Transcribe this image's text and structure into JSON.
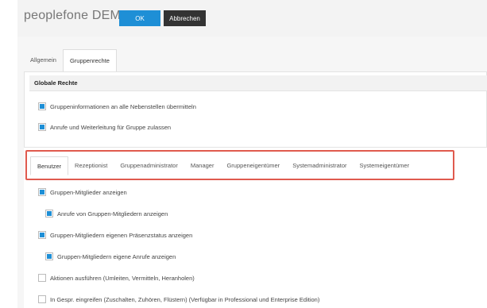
{
  "header": {
    "title": "peoplefone DEMO",
    "ok_label": "OK",
    "cancel_label": "Abbrechen"
  },
  "main_tabs": [
    {
      "label": "Allgemein",
      "active": false
    },
    {
      "label": "Gruppenrechte",
      "active": true
    }
  ],
  "global_rights": {
    "title": "Globale Rechte",
    "options": [
      {
        "label": "Gruppeninformationen an alle Nebenstellen übermitteln",
        "checked": true
      },
      {
        "label": "Anrufe und Weiterleitung für Gruppe zulassen",
        "checked": true
      }
    ]
  },
  "role_tabs": [
    {
      "label": "Benutzer",
      "active": true
    },
    {
      "label": "Rezeptionist",
      "active": false
    },
    {
      "label": "Gruppenadministrator",
      "active": false
    },
    {
      "label": "Manager",
      "active": false
    },
    {
      "label": "Gruppeneigentümer",
      "active": false
    },
    {
      "label": "Systemadministrator",
      "active": false
    },
    {
      "label": "Systemeigentümer",
      "active": false
    }
  ],
  "permissions": [
    {
      "label": "Gruppen-Mitglieder anzeigen",
      "checked": true,
      "indent": false
    },
    {
      "label": "Anrufe von Gruppen-Mitgliedern anzeigen",
      "checked": true,
      "indent": true
    },
    {
      "label": "Gruppen-Mitgliedern eigenen Präsenzstatus anzeigen",
      "checked": true,
      "indent": false
    },
    {
      "label": "Gruppen-Mitgliedern eigene Anrufe anzeigen",
      "checked": true,
      "indent": true
    },
    {
      "label": "Aktionen ausführen (Umleiten, Vermitteln, Heranholen)",
      "checked": false,
      "indent": false
    },
    {
      "label": "In Gespr. eingreifen (Zuschalten, Zuhören, Flüstern) (Verfügbar in Professional und Enterprise Edition)",
      "checked": false,
      "indent": false
    }
  ],
  "colors": {
    "accent": "#1e8fd6",
    "highlight_border": "#e05a4e",
    "dark_button": "#333333"
  }
}
